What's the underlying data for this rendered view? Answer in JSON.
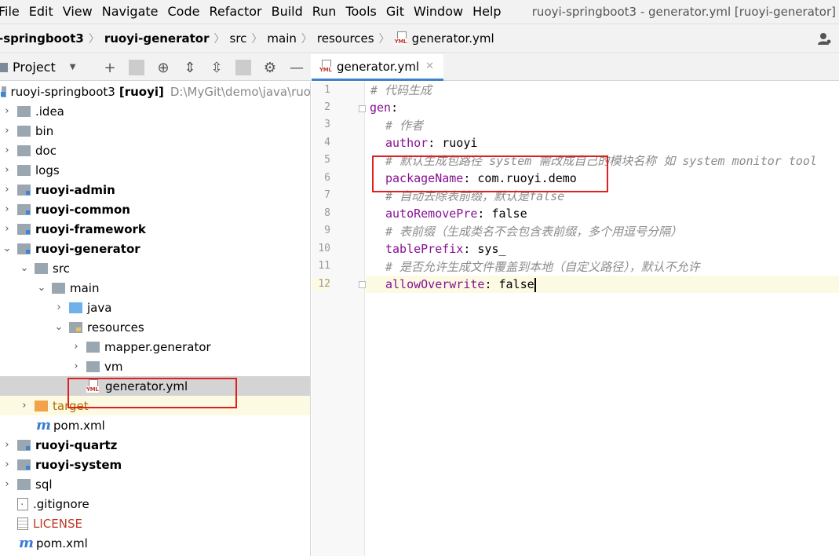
{
  "menubar": {
    "items": [
      "File",
      "Edit",
      "View",
      "Navigate",
      "Code",
      "Refactor",
      "Build",
      "Run",
      "Tools",
      "Git",
      "Window",
      "Help"
    ],
    "window_title": "ruoyi-springboot3 - generator.yml [ruoyi-generator]"
  },
  "breadcrumb": [
    "-springboot3",
    "ruoyi-generator",
    "src",
    "main",
    "resources",
    "generator.yml"
  ],
  "project_panel": {
    "title": "Project"
  },
  "tree": {
    "root_name": "ruoyi-springboot3",
    "root_module": "[ruoyi]",
    "root_path": "D:\\MyGit\\demo\\java\\ruo",
    "items": [
      {
        "label": ".idea"
      },
      {
        "label": "bin"
      },
      {
        "label": "doc"
      },
      {
        "label": "logs"
      },
      {
        "label": "ruoyi-admin"
      },
      {
        "label": "ruoyi-common"
      },
      {
        "label": "ruoyi-framework"
      },
      {
        "label": "ruoyi-generator"
      },
      {
        "label": "src"
      },
      {
        "label": "main"
      },
      {
        "label": "java"
      },
      {
        "label": "resources"
      },
      {
        "label": "mapper.generator"
      },
      {
        "label": "vm"
      },
      {
        "label": "generator.yml"
      },
      {
        "label": "target"
      },
      {
        "label": "pom.xml"
      },
      {
        "label": "ruoyi-quartz"
      },
      {
        "label": "ruoyi-system"
      },
      {
        "label": "sql"
      },
      {
        "label": ".gitignore"
      },
      {
        "label": "LICENSE"
      },
      {
        "label": "pom.xml"
      }
    ]
  },
  "editor": {
    "tab_label": "generator.yml",
    "line_numbers": [
      "1",
      "2",
      "3",
      "4",
      "5",
      "6",
      "7",
      "8",
      "9",
      "10",
      "11",
      "12"
    ],
    "lines": {
      "l1": "# 代码生成",
      "l2_key": "gen",
      "l3": "# 作者",
      "l4_key": "author",
      "l4_val": "ruoyi",
      "l5": "# 默认生成包路径 system 需改成自己的模块名称 如 system monitor tool",
      "l6_key": "packageName",
      "l6_val": "com.ruoyi.demo",
      "l7": "# 自动去除表前缀，默认是false",
      "l8_key": "autoRemovePre",
      "l8_val": "false",
      "l9": "# 表前缀（生成类名不会包含表前缀，多个用逗号分隔）",
      "l10_key": "tablePrefix",
      "l10_val": "sys_",
      "l11": "# 是否允许生成文件覆盖到本地（自定义路径），默认不允许",
      "l12_key": "allowOverwrite",
      "l12_val": "false"
    }
  },
  "colors": {
    "highlight_box": "#e02020",
    "key": "#871094",
    "comment": "#8c8c8c",
    "selection": "#d4d4d4",
    "tab_underline": "#4083c9"
  }
}
